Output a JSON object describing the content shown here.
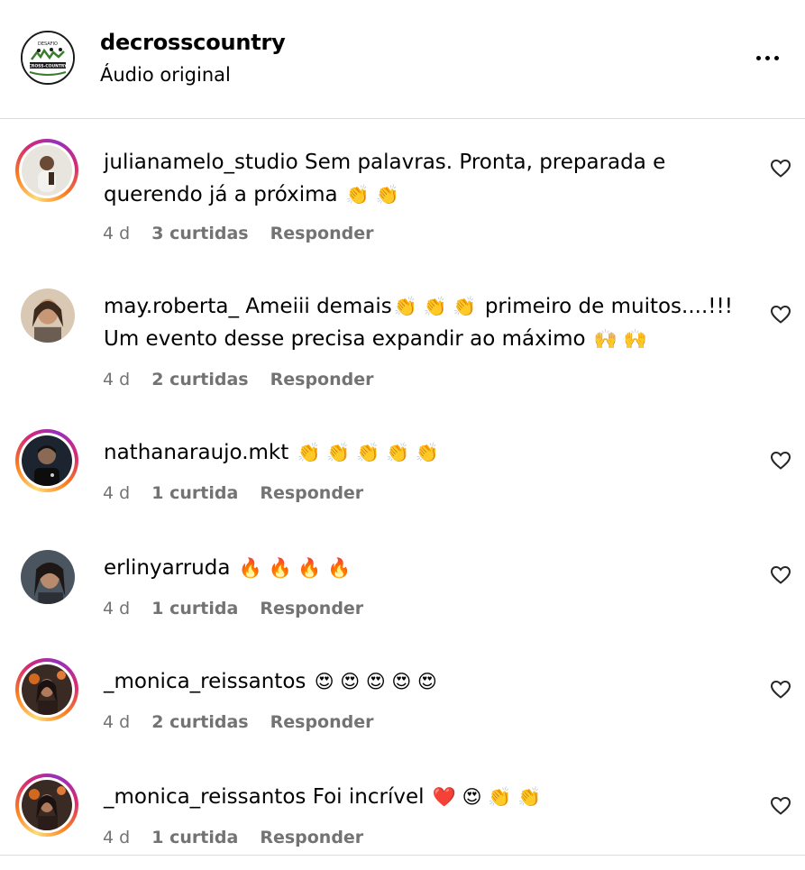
{
  "header": {
    "username": "decrosscountry",
    "subtitle": "Áudio original",
    "logo_text_top": "DESAFIO",
    "logo_text_bottom": "CROSS-COUNTRY",
    "more_icon": "more-horizontal-icon"
  },
  "comments": [
    {
      "username": "julianamelo_studio",
      "text": "Sem palavras. Pronta, preparada e querendo já a próxima",
      "emojis": "👏 👏",
      "time": "4 d",
      "likes": "3 curtidas",
      "reply": "Responder",
      "story_ring": true
    },
    {
      "username": "may.roberta_",
      "text": "Ameiii demais",
      "emojis": "👏 👏 👏",
      "text_after": "primeiro de muitos....!!! Um evento desse precisa expandir ao máximo",
      "emojis_after": "🙌 🙌",
      "time": "4 d",
      "likes": "2 curtidas",
      "reply": "Responder",
      "story_ring": false
    },
    {
      "username": "nathanaraujo.mkt",
      "text": "",
      "emojis": "👏 👏 👏 👏 👏",
      "time": "4 d",
      "likes": "1 curtida",
      "reply": "Responder",
      "story_ring": true
    },
    {
      "username": "erlinyarruda",
      "text": "",
      "emojis": "🔥 🔥 🔥 🔥",
      "time": "4 d",
      "likes": "1 curtida",
      "reply": "Responder",
      "story_ring": false
    },
    {
      "username": "_monica_reissantos",
      "text": "",
      "emojis": "😍 😍 😍 😍 😍",
      "time": "4 d",
      "likes": "2 curtidas",
      "reply": "Responder",
      "story_ring": true
    },
    {
      "username": "_monica_reissantos",
      "text": "Foi incrível",
      "emojis": "❤️ 😍 👏 👏",
      "time": "4 d",
      "likes": "1 curtida",
      "reply": "Responder",
      "story_ring": true
    }
  ],
  "colors": {
    "meta_gray": "#737373",
    "divider": "#dbdbdb",
    "ring_start": "#feda75",
    "ring_mid": "#d62976",
    "ring_end": "#962fbf"
  }
}
